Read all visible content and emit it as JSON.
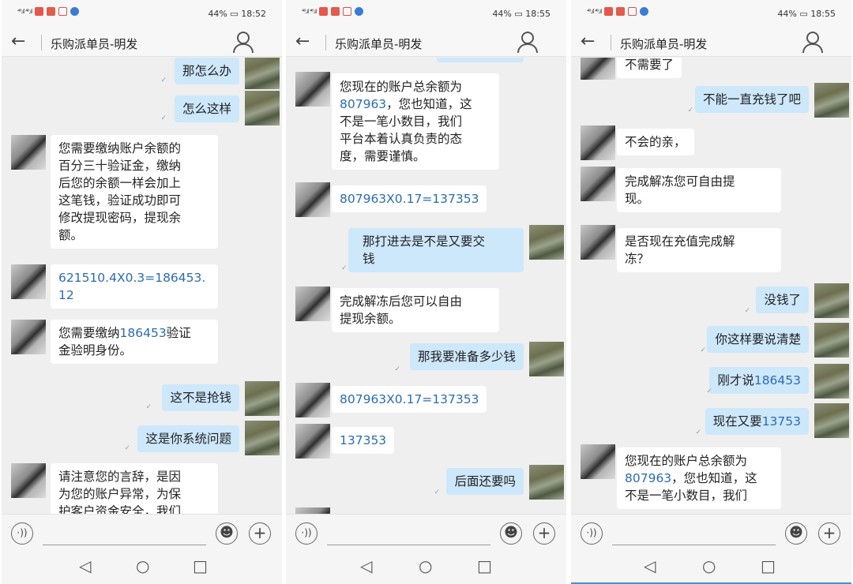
{
  "phones": [
    {
      "status": {
        "signal": "⁴⁶.ıl ⁴⁶.ıl",
        "battery": "44%",
        "time": "18:52"
      },
      "header": {
        "back": "←",
        "title": "乐购派单员-明发"
      },
      "messages": [
        {
          "side": "out",
          "text": "那怎么办"
        },
        {
          "side": "out",
          "text": "怎么这样"
        },
        {
          "side": "in",
          "text": "您需要缴纳账户余额的\n百分三十验证金，缴纳\n后您的余额一样会加上\n这笔钱，验证成功即可\n修改提现密码，提现余\n额。"
        },
        {
          "side": "in",
          "text": "621510.4X0.3=186453.\n12"
        },
        {
          "side": "in",
          "text": "您需要缴纳186453验证\n金验明身份。"
        },
        {
          "side": "out",
          "text": "这不是抢钱"
        },
        {
          "side": "out",
          "text": "这是你系统问题"
        },
        {
          "side": "in",
          "text": "请注意您的言辞，是因\n为您的账户异常，为保\n护客户资金安全，我们"
        }
      ]
    },
    {
      "status": {
        "signal": "⁴⁶.ıl ⁴⁶.ıl",
        "battery": "44%",
        "time": "18:55"
      },
      "header": {
        "back": "←",
        "title": "乐购派单员-明发"
      },
      "messages": [
        {
          "side": "in",
          "text": "您现在的账户总余额为\n807963，您也知道，这\n不是一笔小数目，我们\n平台本着认真负责的态\n度，需要谨慎。"
        },
        {
          "side": "in",
          "text": "807963X0.17=137353"
        },
        {
          "side": "out",
          "text": "那打进去是不是又要交\n钱"
        },
        {
          "side": "in",
          "text": "完成解冻后您可以自由\n提现余额。"
        },
        {
          "side": "out",
          "text": "那我要准备多少钱"
        },
        {
          "side": "in",
          "text": "807963X0.17=137353"
        },
        {
          "side": "in",
          "text": "137353"
        },
        {
          "side": "out",
          "text": "后面还要吗"
        }
      ]
    },
    {
      "status": {
        "signal": "⁴⁶.ıl ⁴⁶.ıl",
        "battery": "44%",
        "time": "18:55"
      },
      "header": {
        "back": "←",
        "title": "乐购派单员-明发"
      },
      "messages": [
        {
          "side": "in",
          "text": "不需要了"
        },
        {
          "side": "out",
          "text": "不能一直充钱了吧"
        },
        {
          "side": "in",
          "text": "不会的亲，"
        },
        {
          "side": "in",
          "text": "完成解冻您可自由提\n现。"
        },
        {
          "side": "in",
          "text": "是否现在充值完成解\n冻？"
        },
        {
          "side": "out",
          "text": "没钱了"
        },
        {
          "side": "out",
          "text": "你这样要说清楚"
        },
        {
          "side": "out",
          "text": "刚才说186453"
        },
        {
          "side": "out",
          "text": "现在又要13753"
        },
        {
          "side": "in",
          "text": "您现在的账户总余额为\n807963，您也知道，这\n不是一笔小数目，我们"
        }
      ]
    }
  ],
  "input_bar": {
    "voice_icon": "·))",
    "emoji_icon": "☻",
    "plus_icon": "+"
  },
  "nav_bar": {
    "back": "◁",
    "home": "○",
    "recent": "□"
  },
  "colors": {
    "bubble_out": "#cde7fb",
    "bubble_in": "#ffffff",
    "number_link": "#2b6cb0"
  }
}
